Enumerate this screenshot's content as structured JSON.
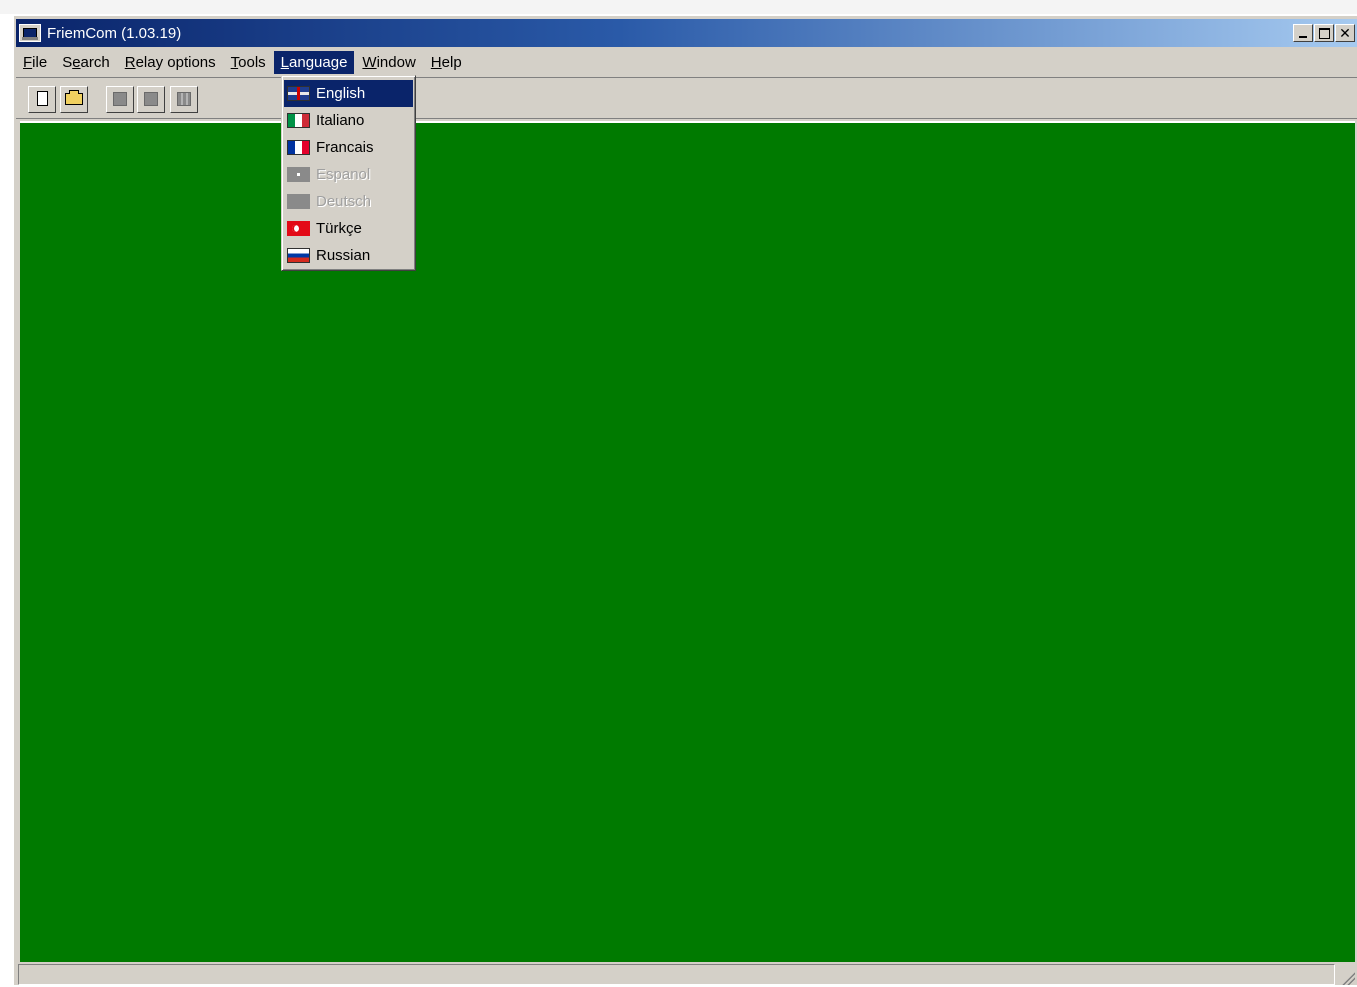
{
  "window": {
    "title": "FriemCom (1.03.19)",
    "controls": [
      "minimize",
      "maximize",
      "close"
    ]
  },
  "menubar": {
    "items": [
      {
        "label": "File",
        "accel": "F",
        "rest": "ile"
      },
      {
        "label": "Search",
        "pre": "S",
        "accel": "e",
        "rest": "arch"
      },
      {
        "label": "Relay options",
        "accel": "R",
        "rest": "elay options"
      },
      {
        "label": "Tools",
        "accel": "T",
        "rest": "ools"
      },
      {
        "label": "Language",
        "accel": "L",
        "rest": "anguage",
        "active": true
      },
      {
        "label": "Window",
        "accel": "W",
        "rest": "indow"
      },
      {
        "label": "Help",
        "accel": "H",
        "rest": "elp"
      }
    ]
  },
  "toolbar": {
    "buttons": [
      {
        "icon": "new-document-icon",
        "enabled": true
      },
      {
        "icon": "open-folder-icon",
        "enabled": true
      },
      {
        "icon": "relay-connect-icon",
        "enabled": false
      },
      {
        "icon": "relay-list-icon",
        "enabled": false
      },
      {
        "icon": "relay-columns-icon",
        "enabled": false
      }
    ]
  },
  "language_menu": {
    "items": [
      {
        "label": "English",
        "flag": "gb",
        "selected": true,
        "enabled": true
      },
      {
        "label": "Italiano",
        "flag": "it",
        "selected": false,
        "enabled": true
      },
      {
        "label": "Francais",
        "flag": "fr",
        "selected": false,
        "enabled": true
      },
      {
        "label": "Espanol",
        "flag": "es",
        "selected": false,
        "enabled": false
      },
      {
        "label": "Deutsch",
        "flag": "de",
        "selected": false,
        "enabled": false
      },
      {
        "label": "Türkçe",
        "flag": "tr",
        "selected": false,
        "enabled": true
      },
      {
        "label": "Russian",
        "flag": "ru",
        "selected": false,
        "enabled": true
      }
    ]
  },
  "colors": {
    "client_background": "#007a00",
    "title_gradient_start": "#0a246a",
    "title_gradient_end": "#a6caf0",
    "highlight": "#0a246a",
    "chrome": "#d4d0c8"
  }
}
